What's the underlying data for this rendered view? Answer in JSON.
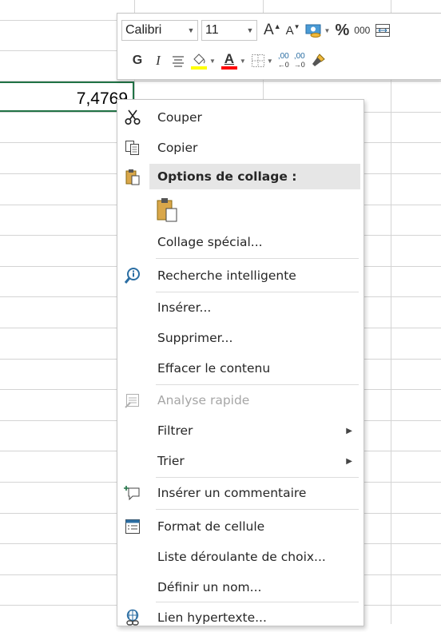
{
  "cell": {
    "value": "7,4769"
  },
  "toolbar": {
    "font": "Calibri",
    "size": "11",
    "grow_font": "A",
    "shrink_font": "A",
    "percent": "%",
    "thousands": "000",
    "bold": "G",
    "italic": "I",
    "font_color_letter": "A",
    "inc_decimal": ",00",
    "dec_decimal": ",00",
    "fill_color": "#ffff00",
    "font_color": "#ff0000"
  },
  "menu": {
    "cut": "Couper",
    "copy": "Copier",
    "paste_options": "Options de collage :",
    "paste_special": "Collage spécial...",
    "smart_lookup": "Recherche intelligente",
    "insert": "Insérer...",
    "delete": "Supprimer...",
    "clear_contents": "Effacer le contenu",
    "quick_analysis": "Analyse rapide",
    "filter": "Filtrer",
    "sort": "Trier",
    "insert_comment": "Insérer un commentaire",
    "format_cells": "Format de cellule",
    "pick_list": "Liste déroulante de choix...",
    "define_name": "Définir un nom...",
    "hyperlink": "Lien hypertexte..."
  }
}
